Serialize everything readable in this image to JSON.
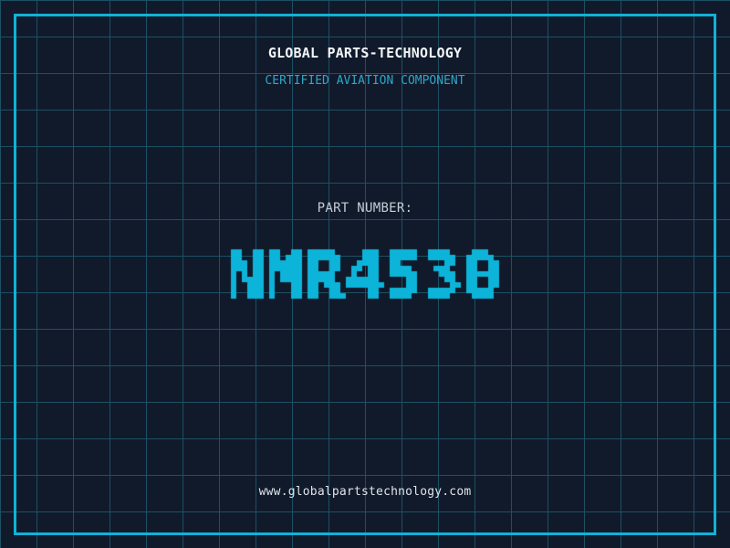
{
  "colors": {
    "background": "#101a2b",
    "grid_line": "#1d5064",
    "frame_border": "#10b2d8",
    "part_number_accent": "#0db4d9",
    "title_text": "#f2f5f7",
    "subtitle_text": "#2fa6c9",
    "label_text": "#c6cdd6",
    "url_text": "#dfe4e8"
  },
  "header": {
    "company_name": "GLOBAL PARTS-TECHNOLOGY",
    "subtitle": "CERTIFIED AVIATION COMPONENT"
  },
  "part_number": {
    "label": "PART NUMBER:",
    "value": "NMR4530"
  },
  "footer": {
    "website": "www.globalpartstechnology.com"
  }
}
